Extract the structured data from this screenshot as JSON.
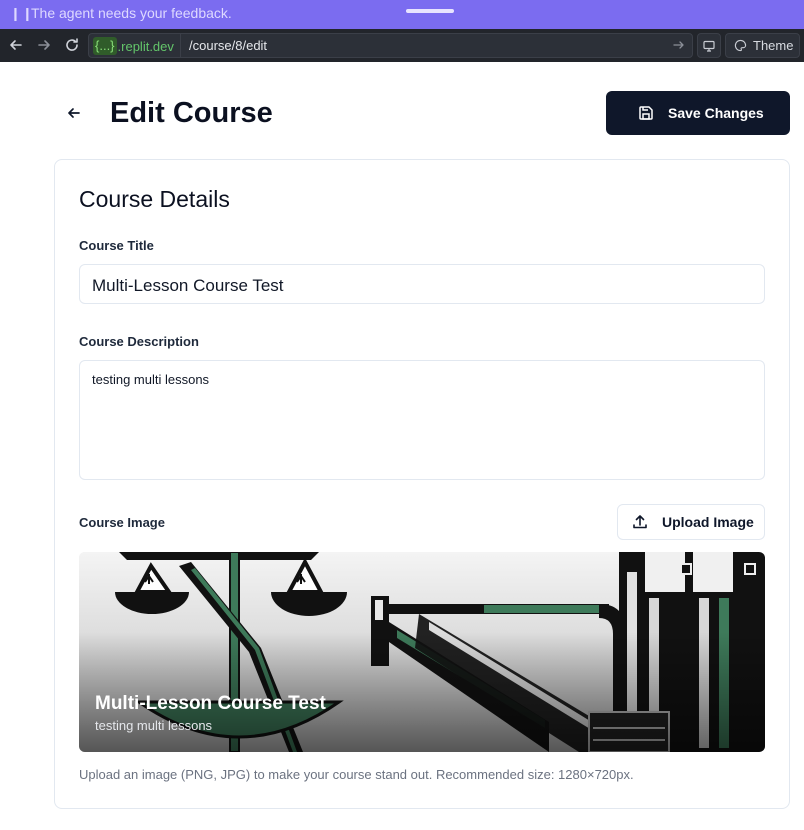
{
  "agent_banner": {
    "message": "The agent needs your feedback."
  },
  "browser": {
    "url_host_chip": "{...}",
    "url_host_domain": ".replit.dev",
    "url_path": "/course/8/edit",
    "theme_label": "Theme"
  },
  "header": {
    "title": "Edit Course",
    "save_label": "Save Changes"
  },
  "course_details": {
    "heading": "Course Details",
    "title_label": "Course Title",
    "title_value": "Multi-Lesson Course Test",
    "description_label": "Course Description",
    "description_value": "testing multi lessons",
    "image_label": "Course Image",
    "upload_label": "Upload Image",
    "preview_title": "Multi-Lesson Course Test",
    "preview_description": "testing multi lessons",
    "help_text": "Upload an image (PNG, JPG) to make your course stand out. Recommended size: 1280×720px."
  },
  "colors": {
    "agent_banner": "#7b6cf0",
    "primary_button": "#0f172a",
    "art_green": "#3e7a5a"
  },
  "icons": [
    "pause-icon",
    "back-arrow-icon",
    "forward-arrow-icon",
    "reload-icon",
    "go-arrow-icon",
    "devtools-icon",
    "palette-icon",
    "arrow-left-icon",
    "save-icon",
    "upload-icon"
  ]
}
